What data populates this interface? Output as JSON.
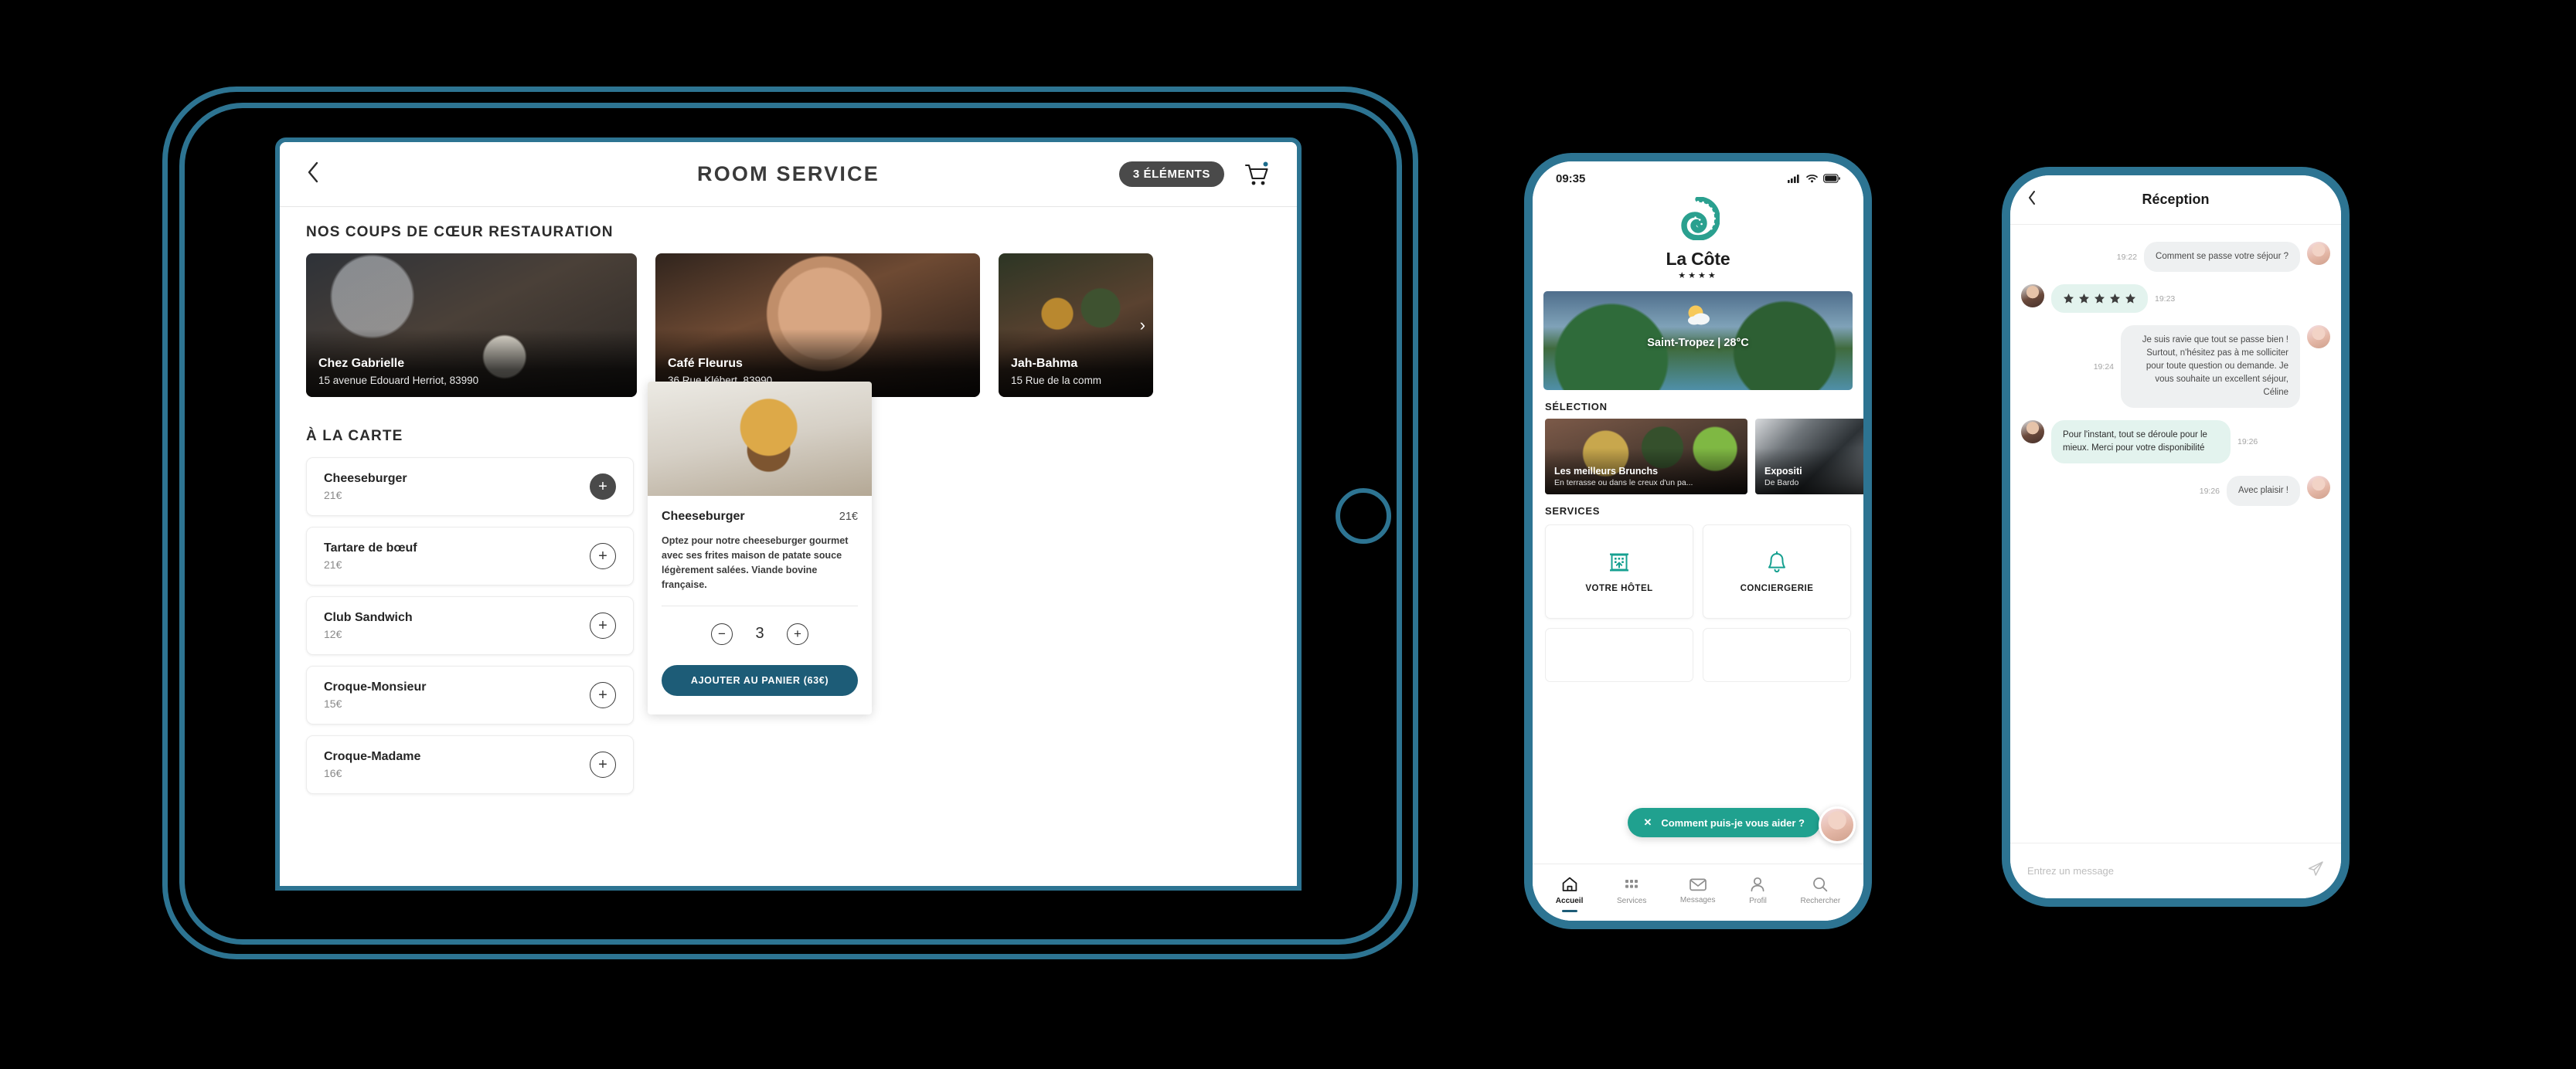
{
  "tablet": {
    "header": {
      "back_icon": "chevron-left-icon",
      "title": "ROOM SERVICE",
      "cart_badge": "3 ÉLÉMENTS",
      "cart_icon": "shopping-cart-icon"
    },
    "featured_section_title": "NOS COUPS DE CŒUR RESTAURATION",
    "featured": [
      {
        "name": "Chez Gabrielle",
        "address": "15 avenue Edouard Herriot, 83990"
      },
      {
        "name": "Café Fleurus",
        "address": "36 Rue Klébert, 83990"
      },
      {
        "name": "Jah-Bahma",
        "address": "15 Rue de la comm"
      }
    ],
    "carousel_next_icon": "chevron-right-icon",
    "menu_section_title": "À LA CARTE",
    "menu_items": [
      {
        "name": "Cheeseburger",
        "price": "21€"
      },
      {
        "name": "Tartare de bœuf",
        "price": "21€"
      },
      {
        "name": "Club Sandwich",
        "price": "12€"
      },
      {
        "name": "Croque-Monsieur",
        "price": "15€"
      },
      {
        "name": "Croque-Madame",
        "price": "16€"
      }
    ],
    "detail": {
      "name": "Cheeseburger",
      "price": "21€",
      "description": "Optez pour notre cheeseburger gourmet avec ses frites maison de patate souce légèrement salées. Viande bovine française.",
      "minus_label": "−",
      "quantity": "3",
      "plus_label": "+",
      "cta": "AJOUTER AU PANIER (63€)"
    }
  },
  "phone_home": {
    "status": {
      "time": "09:35",
      "signal_icon": "cellular-bars-icon",
      "wifi_icon": "wifi-icon",
      "battery_icon": "battery-full-icon"
    },
    "hotel": {
      "logo_icon": "spiral-shell-logo",
      "name": "La Côte",
      "stars": "★★★★"
    },
    "hero": {
      "label": "Saint-Tropez | 28°C",
      "weather_icon": "sun-behind-cloud-icon"
    },
    "selection_title": "SÉLECTION",
    "selection": [
      {
        "name": "Les meilleurs Brunchs",
        "subtitle": "En terrasse ou dans le creux d'un pa..."
      },
      {
        "name": "Expositi",
        "subtitle": "De Bardo"
      }
    ],
    "services_title": "SERVICES",
    "services": [
      {
        "label": "VOTRE HÔTEL",
        "icon": "hotel-building-icon"
      },
      {
        "label": "CONCIERGERIE",
        "icon": "bell-icon"
      }
    ],
    "assistant": {
      "close_icon": "close-icon",
      "text": "Comment puis-je vous aider ?",
      "avatar": "concierge-avatar"
    },
    "tabs": [
      {
        "label": "Accueil",
        "icon": "home-icon",
        "active": true
      },
      {
        "label": "Services",
        "icon": "grid-icon",
        "active": false
      },
      {
        "label": "Messages",
        "icon": "envelope-icon",
        "active": false
      },
      {
        "label": "Profil",
        "icon": "person-icon",
        "active": false
      },
      {
        "label": "Rechercher",
        "icon": "search-icon",
        "active": false
      }
    ]
  },
  "phone_chat": {
    "header": {
      "back_icon": "chevron-left-icon",
      "title": "Réception"
    },
    "messages": [
      {
        "side": "right",
        "time": "19:22",
        "kind": "text",
        "text": "Comment se passe votre séjour ?",
        "avatar": "concierge-avatar"
      },
      {
        "side": "left",
        "time": "19:23",
        "kind": "stars",
        "stars": 5,
        "avatar": "guest-avatar"
      },
      {
        "side": "right",
        "time": "19:24",
        "kind": "text",
        "text": "Je suis ravie que tout se passe bien ! Surtout, n'hésitez pas à me solliciter pour toute question ou demande. Je vous souhaite un excellent séjour, Céline",
        "avatar": "concierge-avatar"
      },
      {
        "side": "left",
        "time": "19:26",
        "kind": "text",
        "text": "Pour l'instant, tout se déroule pour le mieux. Merci pour votre disponibilité",
        "avatar": "guest-avatar"
      },
      {
        "side": "right",
        "time": "19:26",
        "kind": "text",
        "text": "Avec plaisir !",
        "avatar": "concierge-avatar"
      }
    ],
    "input": {
      "placeholder": "Entrez un message",
      "send_icon": "paper-plane-icon"
    }
  },
  "colors": {
    "device_frame": "#2d7492",
    "accent_teal": "#20a18f",
    "cta_blue": "#1d5c77",
    "badge_grey": "#4a4a4a",
    "background": "#000000"
  }
}
